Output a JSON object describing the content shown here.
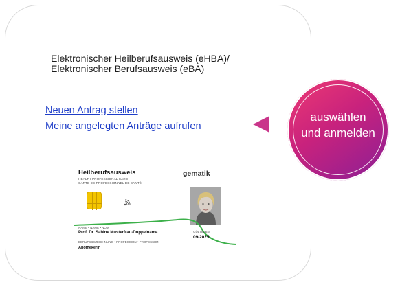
{
  "card": {
    "title_line1": "Elektronischer Heilberufsausweis (eHBA)/",
    "title_line2": "Elektronischer Berufsausweis (eBA)",
    "link_new": "Neuen Antrag stellen",
    "link_existing": "Meine angelegten Anträge aufrufen"
  },
  "badge": {
    "line1": "auswählen",
    "line2": "und anmelden"
  },
  "health_card": {
    "title": "Heilberufsausweis",
    "sub1": "HEALTH PROFESSIONAL CARD",
    "sub2": "CARTE DE PROFESSIONNEL DE SANTÉ",
    "brand": "gematik",
    "name_label": "NAME • NAME • NOM",
    "name": "Prof. Dr. Sabine Musterfrau-Doppelname",
    "valid_label": "GÜLTIG BIS",
    "valid_until": "09/2025",
    "profession_label": "BERUFSBEZEICHNUNG • PROFESSION • PROFESSION",
    "profession": "Apothekerin"
  },
  "colors": {
    "link": "#1f3ec8",
    "accent_pink": "#c9358a",
    "badge_gradient_start": "#ee3a73",
    "badge_gradient_end": "#8a1f96",
    "chip": "#f3c500",
    "card_wave": "#3cb04a"
  }
}
